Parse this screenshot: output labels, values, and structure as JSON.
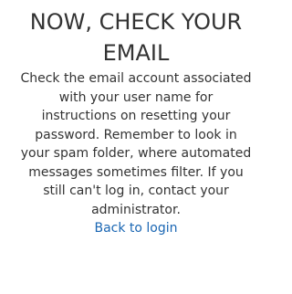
{
  "heading": {
    "line1": "NOW, CHECK YOUR",
    "line2": "EMAIL"
  },
  "message": {
    "lines": [
      "Check the email account associated",
      "with your user name for",
      "instructions on resetting your",
      "password. Remember to look in",
      "your spam folder, where automated",
      "messages sometimes filter. If you",
      "still can't log in, contact your",
      "administrator."
    ]
  },
  "links": {
    "back_to_login": "Back to login"
  },
  "colors": {
    "text": "#333333",
    "link": "#1a66b3",
    "background": "#ffffff"
  }
}
